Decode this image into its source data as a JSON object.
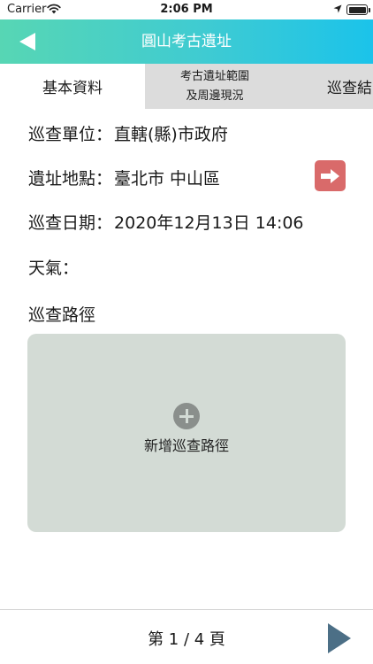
{
  "status_bar": {
    "carrier": "Carrier",
    "time": "2:06 PM",
    "wifi_icon": "wifi-icon",
    "location_icon": "location-arrow-icon",
    "battery_icon": "battery-icon"
  },
  "nav": {
    "title": "圓山考古遺址",
    "back_icon": "back-triangle-icon",
    "gradient": [
      "#57d6b4",
      "#1bc3ea"
    ]
  },
  "tabs": [
    {
      "label": "基本資料",
      "active": true
    },
    {
      "label_line1": "考古遺址範圍",
      "label_line2": "及周邊現況",
      "active": false
    },
    {
      "label": "巡查結",
      "active": false
    }
  ],
  "fields": {
    "unit": {
      "label": "巡查單位：",
      "value": "直轄(縣)市政府"
    },
    "location": {
      "label": "遺址地點：",
      "value": "臺北市 中山區",
      "button_icon": "arrow-right-icon",
      "button_color": "#d96a6a"
    },
    "date": {
      "label": "巡查日期：",
      "value": "2020年12月13日 14:06"
    },
    "weather": {
      "label": "天氣：",
      "value": ""
    }
  },
  "route": {
    "heading": "巡查路徑",
    "add_label": "新增巡查路徑",
    "add_icon": "plus-circle-icon",
    "box_color": "#d3dbd5"
  },
  "footer": {
    "page_text": "第 1 / 4 頁",
    "next_icon": "next-triangle-icon"
  }
}
